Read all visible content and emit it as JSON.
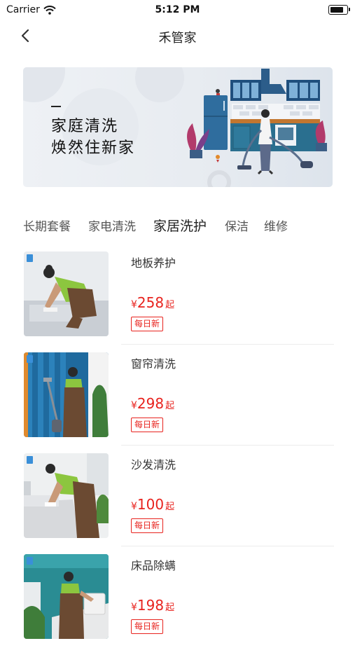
{
  "status_bar": {
    "carrier": "Carrier",
    "time": "5:12 PM"
  },
  "nav": {
    "title": "禾管家"
  },
  "banner": {
    "line1": "家庭清洗",
    "line2": "焕然住新家"
  },
  "tabs": [
    {
      "label": "长期套餐",
      "active": false
    },
    {
      "label": "家电清洗",
      "active": false
    },
    {
      "label": "家居洗护",
      "active": true
    },
    {
      "label": "保洁",
      "active": false
    },
    {
      "label": "维修",
      "active": false
    }
  ],
  "items": [
    {
      "name": "地板养护",
      "currency": "¥",
      "price": "258",
      "price_suffix": "起",
      "badge": "每日新",
      "image": "cleaner-kneeling-floor"
    },
    {
      "name": "窗帘清洗",
      "currency": "¥",
      "price": "298",
      "price_suffix": "起",
      "badge": "每日新",
      "image": "cleaner-vacuum-curtain"
    },
    {
      "name": "沙发清洗",
      "currency": "¥",
      "price": "100",
      "price_suffix": "起",
      "badge": "每日新",
      "image": "cleaner-sofa"
    },
    {
      "name": "床品除螨",
      "currency": "¥",
      "price": "198",
      "price_suffix": "起",
      "badge": "每日新",
      "image": "cleaner-bedding"
    }
  ],
  "colors": {
    "price": "#e8231e",
    "apron": "#6b4a32",
    "shirt": "#8cc63f"
  }
}
